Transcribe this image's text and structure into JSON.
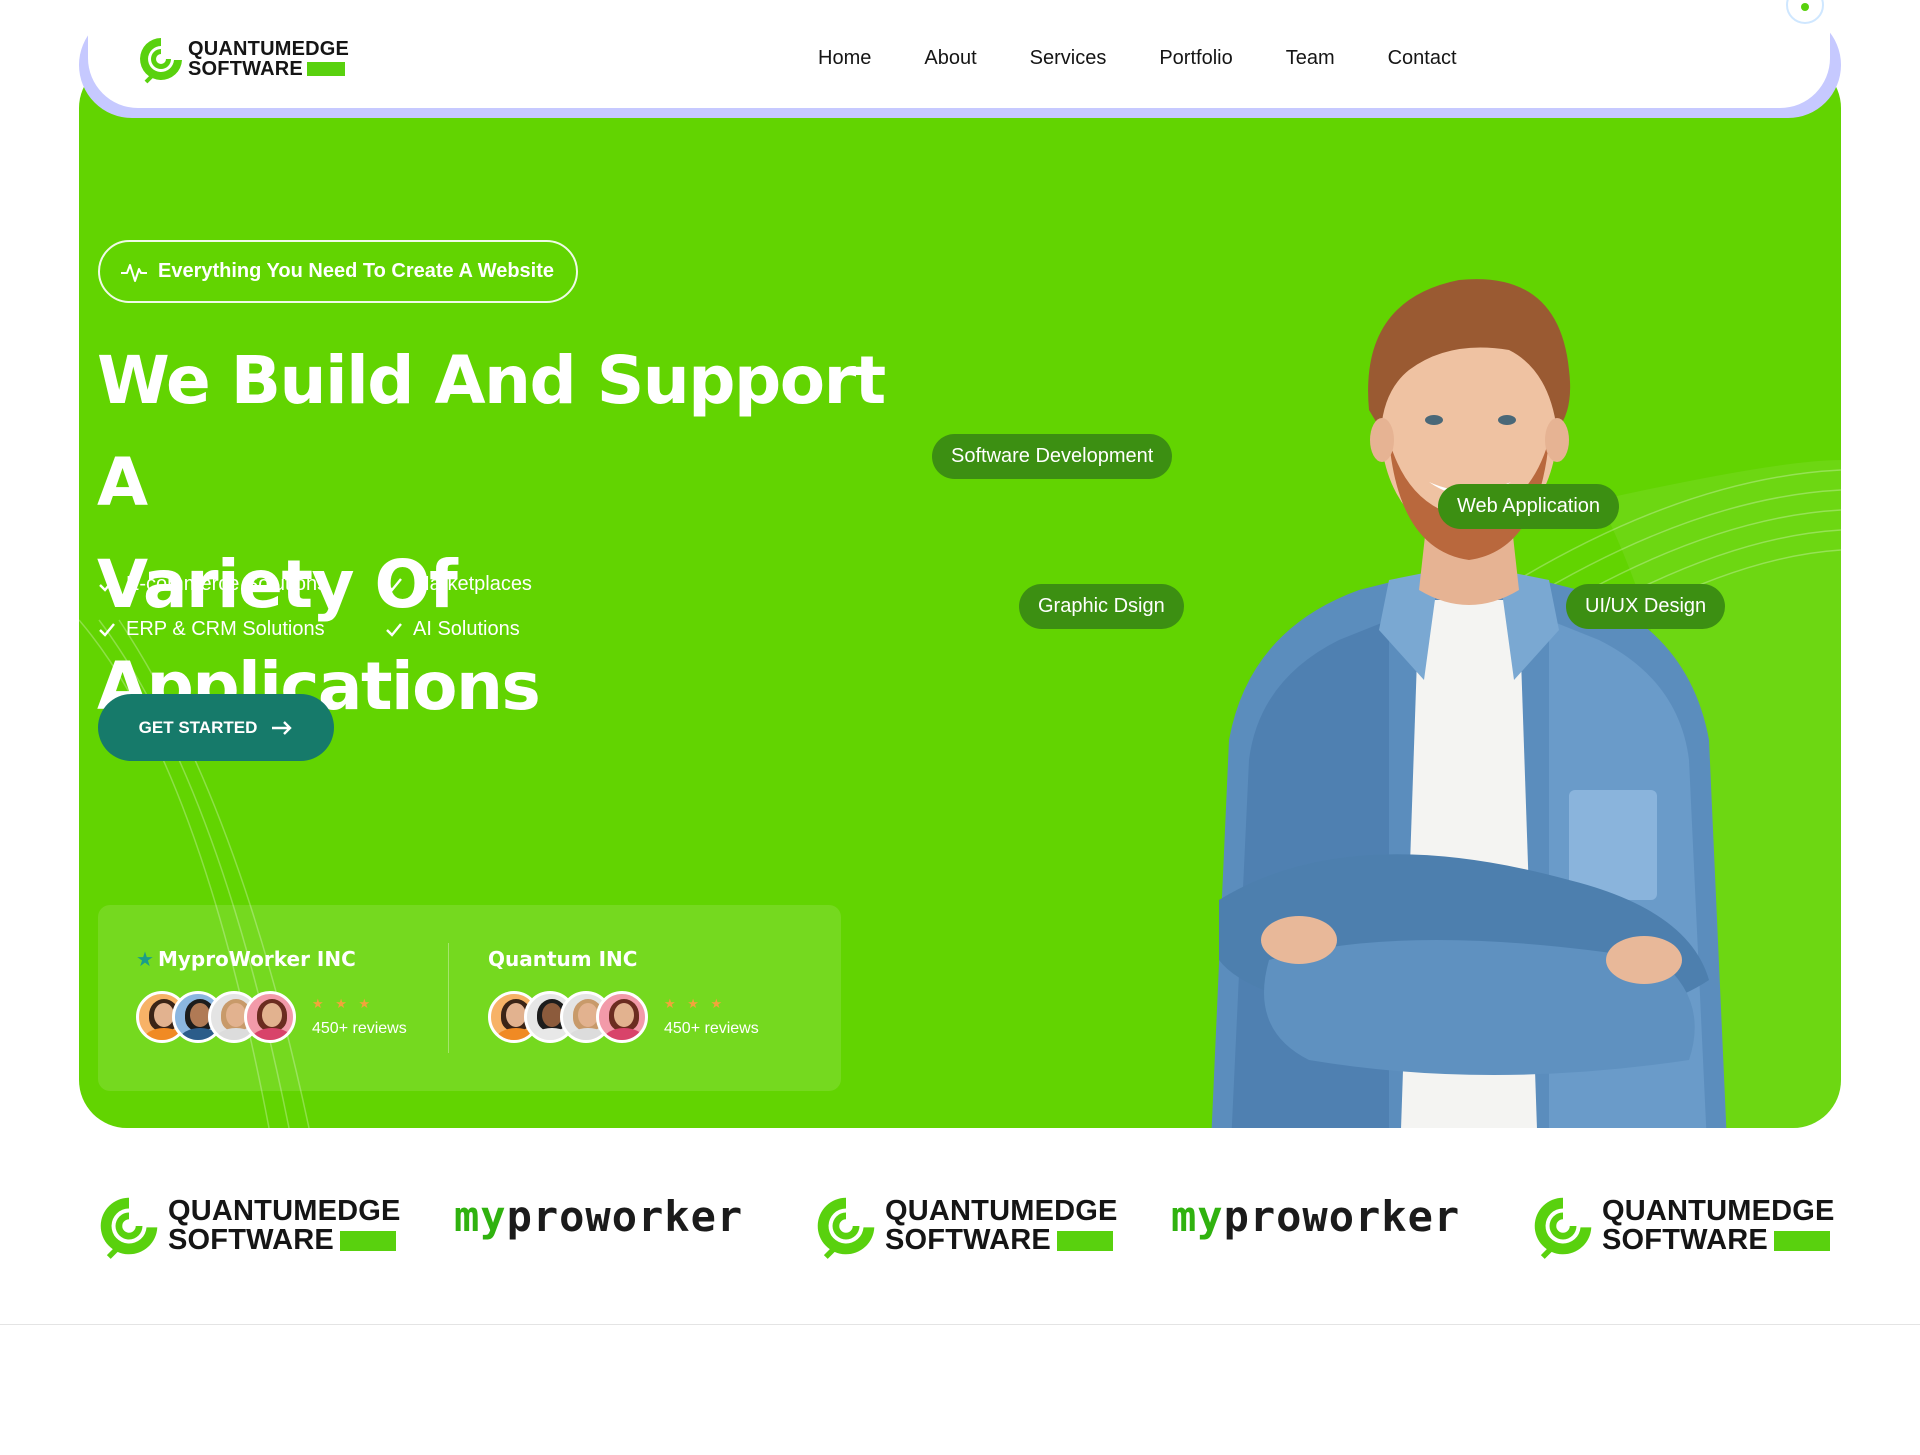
{
  "brand": {
    "line1": "QUANTUMEDGE",
    "line2": "SOFTWARE",
    "accent_color": "#59d10e"
  },
  "nav": {
    "items": [
      "Home",
      "About",
      "Services",
      "Portfolio",
      "Team",
      "Contact"
    ]
  },
  "hero": {
    "background_color": "#62d401",
    "pill_text": "Everything You Need To Create A Website",
    "pill_icon": "pulse-icon",
    "headline_line1": "We Build And Support A",
    "headline_line2": "Variety Of Applications",
    "features": [
      "E-commerce Solutions",
      "Marketplaces",
      "ERP & CRM Solutions",
      "AI Solutions"
    ],
    "feature_icon": "check-icon",
    "cta_label": "GET STARTED",
    "cta_icon": "arrow-right-icon",
    "cta_color": "#167a6a"
  },
  "reviews": [
    {
      "name": "MyproWorker INC",
      "stars": "★ ★ ★",
      "count": "450+ reviews",
      "has_star_icon": true
    },
    {
      "name": "Quantum INC",
      "stars": "★ ★ ★",
      "count": "450+ reviews",
      "has_star_icon": false
    }
  ],
  "tags": [
    "Software Development",
    "Web Application",
    "Graphic Dsign",
    "UI/UX Design"
  ],
  "partners": {
    "quantum_line1": "QUANTUMEDGE",
    "quantum_line2": "SOFTWARE",
    "mypro_prefix": "my",
    "mypro_rest": "proworker"
  }
}
